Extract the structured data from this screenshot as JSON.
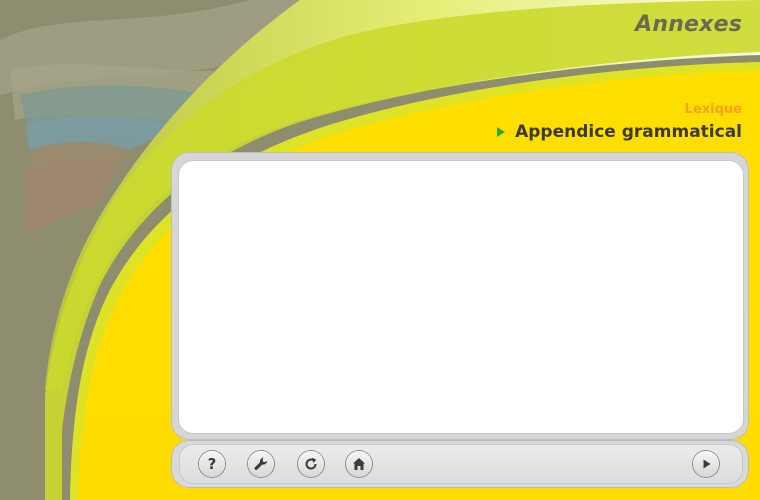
{
  "header": {
    "title": "Annexes"
  },
  "nav": {
    "items": [
      {
        "label": "Lexique"
      },
      {
        "label": "Appendice grammatical"
      }
    ]
  },
  "content": {
    "text": ""
  },
  "toolbar": {
    "buttons": [
      {
        "icon": "help-icon",
        "glyph": "?"
      },
      {
        "icon": "wrench-icon"
      },
      {
        "icon": "refresh-icon"
      },
      {
        "icon": "home-icon"
      },
      {
        "icon": "play-icon"
      }
    ]
  },
  "colors": {
    "background": "#8f8e72",
    "yellow": "#ffde00",
    "lime": "#c9dc2a",
    "title": "#6b6a52",
    "nav_secondary": "#f7a21b",
    "nav_primary": "#3b3a2e",
    "arrow": "#2fae2c"
  }
}
